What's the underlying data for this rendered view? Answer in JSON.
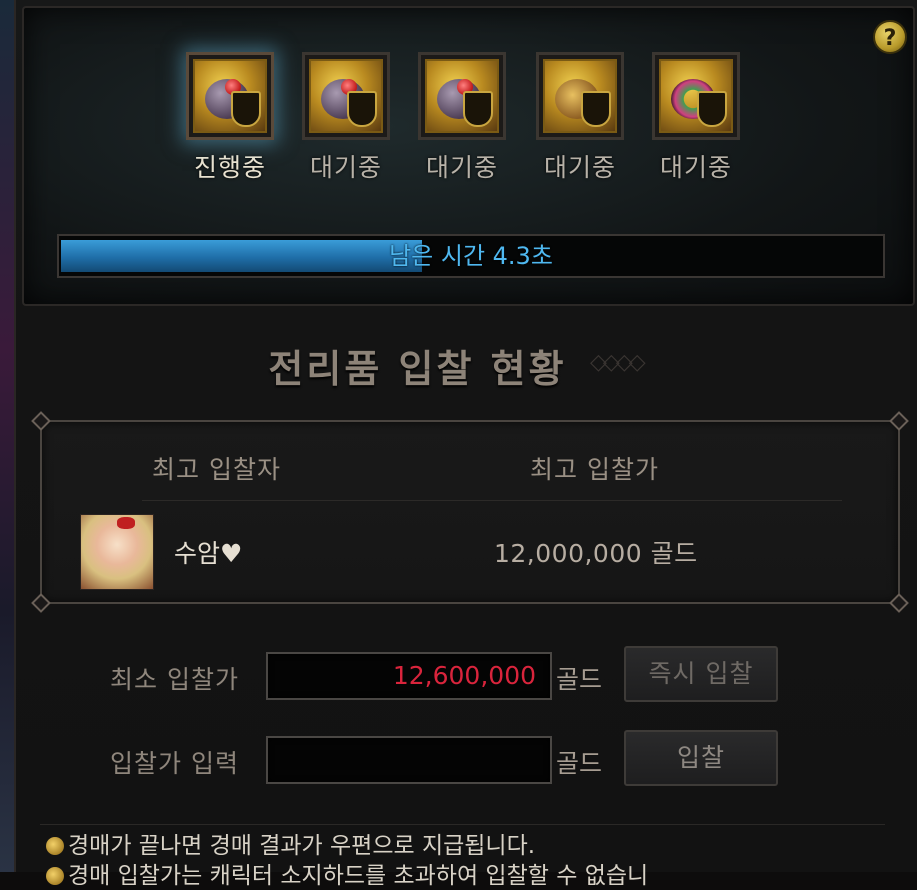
{
  "help_label": "?",
  "items": [
    {
      "label": "진행중",
      "state": "active",
      "icon": "helmet-crest-item-icon"
    },
    {
      "label": "대기중",
      "state": "waiting",
      "icon": "helmet-crest-item-icon"
    },
    {
      "label": "대기중",
      "state": "waiting",
      "icon": "helmet-crest-item-icon"
    },
    {
      "label": "대기중",
      "state": "waiting",
      "icon": "shell-crest-item-icon"
    },
    {
      "label": "대기중",
      "state": "waiting",
      "icon": "ring-crest-item-icon"
    }
  ],
  "timer": {
    "text": "남은 시간 4.3초",
    "progress": 0.44
  },
  "section_title": "전리품 입찰 현황",
  "bid_table": {
    "col_bidder": "최고 입찰자",
    "col_price": "최고 입찰가",
    "bidder_name": "수암♥",
    "bid_amount": "12,000,000 골드"
  },
  "min_bid": {
    "label": "최소 입찰가",
    "value": "12,600,000",
    "unit": "골드",
    "button": "즉시 입찰"
  },
  "bid_input": {
    "label": "입찰가 입력",
    "value": "",
    "unit": "골드",
    "button": "입찰"
  },
  "notices": [
    "경매가 끝나면 경매 결과가 우편으로 지급됩니다.",
    "경매 입찰가는 캐릭터 소지하드를 초과하여 입찰할 수 없습니"
  ],
  "colors": {
    "timer_fill": "#1f6ea8",
    "timer_text": "#4fb8f0",
    "min_bid_value": "#d9243c",
    "accent_gold": "#c9a640"
  }
}
